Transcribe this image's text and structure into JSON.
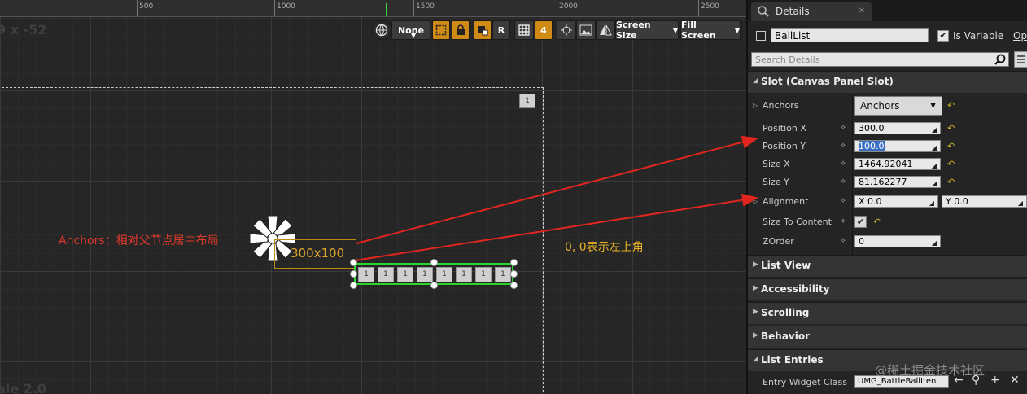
{
  "ruler": {
    "ticks": [
      "500",
      "1000",
      "1500",
      "2000",
      "2500"
    ]
  },
  "canvas": {
    "zoom_readout": "9 x -52",
    "dpi_readout": "ale 2.0",
    "toolbar": {
      "none_label": "None",
      "r_label": "R",
      "grid_snap_value": "4",
      "screen_size_label": "Screen Size",
      "fill_screen_label": "Fill Screen"
    },
    "size_label": "300x100",
    "ball_text": "1",
    "annotation_anchors": "Anchors：相对父节点居中布局",
    "annotation_alignment": "0, 0表示左上角"
  },
  "details": {
    "tab_label": "Details",
    "widget_name": "BallList",
    "is_variable_label": "Is Variable",
    "is_variable_checked": true,
    "op_label": "Op",
    "search_placeholder": "Search Details",
    "slot_section": "Slot (Canvas Panel Slot)",
    "anchors_label": "Anchors",
    "anchors_value": "Anchors",
    "position_x_label": "Position X",
    "position_x": "300.0",
    "position_y_label": "Position Y",
    "position_y": "100.0",
    "size_x_label": "Size X",
    "size_x": "1464.92041",
    "size_y_label": "Size Y",
    "size_y": "81.162277",
    "alignment_label": "Alignment",
    "alignment_x": "X  0.0",
    "alignment_y": "Y  0.0",
    "size_to_content_label": "Size To Content",
    "zorder_label": "ZOrder",
    "zorder": "0",
    "sections": [
      "List View",
      "Accessibility",
      "Scrolling",
      "Behavior",
      "List Entries"
    ],
    "entry_widget_class_label": "Entry Widget Class",
    "entry_widget_class_value": "UMG_BattleBallIten"
  },
  "watermark": "@稀土掘金技术社区",
  "colors": {
    "accent_orange": "#d08a16",
    "selection_green": "#2bd62b",
    "annotation_red": "#e0392c",
    "annotation_yellow": "#e8b224",
    "reset_yellow": "#d0b22a"
  }
}
